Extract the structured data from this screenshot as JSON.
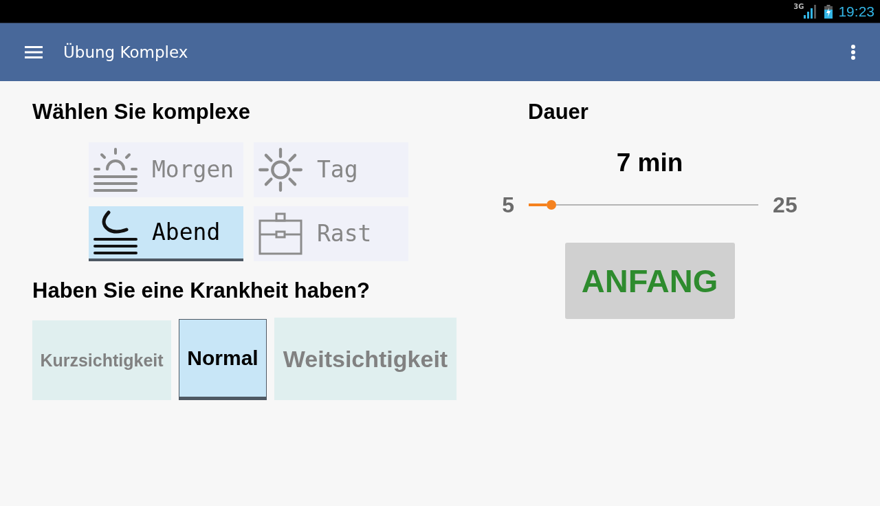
{
  "status_bar": {
    "network": "3G",
    "time": "19:23"
  },
  "app_bar": {
    "title": "Übung Komplex"
  },
  "complexes": {
    "heading": "Wählen Sie komplexe",
    "items": [
      {
        "label": "Morgen",
        "selected": false
      },
      {
        "label": "Tag",
        "selected": false
      },
      {
        "label": "Abend",
        "selected": true
      },
      {
        "label": "Rast",
        "selected": false
      }
    ]
  },
  "conditions": {
    "heading": "Haben Sie eine Krankheit haben?",
    "options": [
      {
        "label": "Kurzsichtigkeit",
        "selected": false
      },
      {
        "label": "Normal",
        "selected": true
      },
      {
        "label": "Weitsichtigkeit",
        "selected": false
      }
    ]
  },
  "duration": {
    "heading": "Dauer",
    "value": "7 min",
    "min_label": "5",
    "max_label": "25",
    "level": 0.1
  },
  "start_button": {
    "label": "ANFANG"
  }
}
